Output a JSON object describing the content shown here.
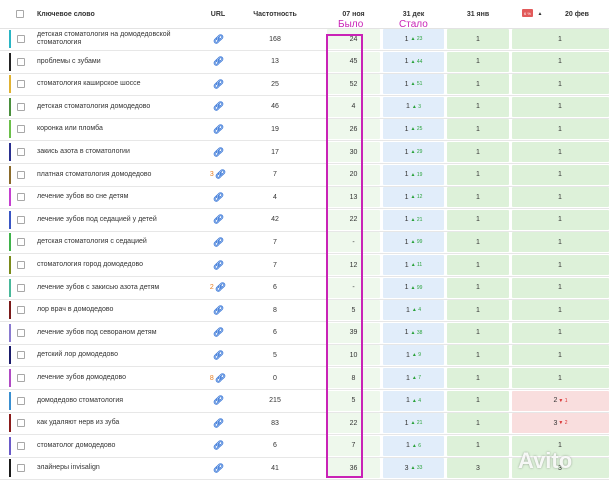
{
  "header": {
    "keyword": "Ключевое слово",
    "url": "URL",
    "frequency": "Частотность",
    "d1": "07 ноя",
    "d2": "31 дек",
    "d3": "31 янв",
    "d4": "20 фев",
    "badge": "6 %",
    "sort_arrow": "▲"
  },
  "annotations": {
    "was": "Было",
    "became": "Стало"
  },
  "watermark": "Avito",
  "rows": [
    {
      "kw": "детская стоматология на домодедовской стоматология",
      "urlnum": "",
      "freq": "168",
      "p1": "24",
      "p2": "1",
      "p2c": "▲ 23",
      "p3": "1",
      "p4": "1",
      "p4c": "",
      "color": "#2ab5c4"
    },
    {
      "kw": "проблемы с зубами",
      "urlnum": "",
      "freq": "13",
      "p1": "45",
      "p2": "1",
      "p2c": "▲ 44",
      "p3": "1",
      "p4": "1",
      "p4c": "",
      "color": "#222222"
    },
    {
      "kw": "стоматология каширское шоссе",
      "urlnum": "",
      "freq": "25",
      "p1": "52",
      "p2": "1",
      "p2c": "▲ 51",
      "p3": "1",
      "p4": "1",
      "p4c": "",
      "color": "#e0b233"
    },
    {
      "kw": "детская стоматология домодедово",
      "urlnum": "",
      "freq": "46",
      "p1": "4",
      "p2": "1",
      "p2c": "▲ 3",
      "p3": "1",
      "p4": "1",
      "p4c": "",
      "color": "#4a8f3c"
    },
    {
      "kw": "коронка или пломба",
      "urlnum": "",
      "freq": "19",
      "p1": "26",
      "p2": "1",
      "p2c": "▲ 25",
      "p3": "1",
      "p4": "1",
      "p4c": "",
      "color": "#6bbf4a"
    },
    {
      "kw": "закись азота в стоматологии",
      "urlnum": "",
      "freq": "17",
      "p1": "30",
      "p2": "1",
      "p2c": "▲ 29",
      "p3": "1",
      "p4": "1",
      "p4c": "",
      "color": "#2a2f8f"
    },
    {
      "kw": "платная стоматология домодедово",
      "urlnum": "3",
      "freq": "7",
      "p1": "20",
      "p2": "1",
      "p2c": "▲ 19",
      "p3": "1",
      "p4": "1",
      "p4c": "",
      "color": "#8a6a2a"
    },
    {
      "kw": "лечение зубов во сне детям",
      "urlnum": "",
      "freq": "4",
      "p1": "13",
      "p2": "1",
      "p2c": "▲ 12",
      "p3": "1",
      "p4": "1",
      "p4c": "",
      "color": "#c43fd0"
    },
    {
      "kw": "лечение зубов под седацией у детей",
      "urlnum": "",
      "freq": "42",
      "p1": "22",
      "p2": "1",
      "p2c": "▲ 21",
      "p3": "1",
      "p4": "1",
      "p4c": "",
      "color": "#3a56c4"
    },
    {
      "kw": "детская стоматология с седацией",
      "urlnum": "",
      "freq": "7",
      "p1": "-",
      "p2": "1",
      "p2c": "▲ 99",
      "p3": "1",
      "p4": "1",
      "p4c": "",
      "color": "#3fb24a"
    },
    {
      "kw": "стоматология город домодедово",
      "urlnum": "",
      "freq": "7",
      "p1": "12",
      "p2": "1",
      "p2c": "▲ 11",
      "p3": "1",
      "p4": "1",
      "p4c": "",
      "color": "#7a8a1a"
    },
    {
      "kw": "лечение зубов с закисью азота детям",
      "urlnum": "2",
      "freq": "6",
      "p1": "-",
      "p2": "1",
      "p2c": "▲ 99",
      "p3": "1",
      "p4": "1",
      "p4c": "",
      "color": "#49b89a"
    },
    {
      "kw": "лор врач в домодедово",
      "urlnum": "",
      "freq": "8",
      "p1": "5",
      "p2": "1",
      "p2c": "▲ 4",
      "p3": "1",
      "p4": "1",
      "p4c": "",
      "color": "#7a1a1a"
    },
    {
      "kw": "лечение зубов под севораном детям",
      "urlnum": "",
      "freq": "6",
      "p1": "39",
      "p2": "1",
      "p2c": "▲ 38",
      "p3": "1",
      "p4": "1",
      "p4c": "",
      "color": "#8a7ad0"
    },
    {
      "kw": "детский лор домодедово",
      "urlnum": "",
      "freq": "5",
      "p1": "10",
      "p2": "1",
      "p2c": "▲ 9",
      "p3": "1",
      "p4": "1",
      "p4c": "",
      "color": "#1a1a6a"
    },
    {
      "kw": "лечение зубов домодедово",
      "urlnum": "8",
      "freq": "0",
      "p1": "8",
      "p2": "1",
      "p2c": "▲ 7",
      "p3": "1",
      "p4": "1",
      "p4c": "",
      "color": "#b04ac4"
    },
    {
      "kw": "домодедово стоматология",
      "urlnum": "",
      "freq": "215",
      "p1": "5",
      "p2": "1",
      "p2c": "▲ 4",
      "p3": "1",
      "p4": "2",
      "p4c": "▼ 1",
      "color": "#3a8fd0"
    },
    {
      "kw": "как удаляют нерв из зуба",
      "urlnum": "",
      "freq": "83",
      "p1": "22",
      "p2": "1",
      "p2c": "▲ 21",
      "p3": "1",
      "p4": "3",
      "p4c": "▼ 2",
      "color": "#8a1a1a"
    },
    {
      "kw": "стоматолог домодедово",
      "urlnum": "",
      "freq": "6",
      "p1": "7",
      "p2": "1",
      "p2c": "▲ 6",
      "p3": "1",
      "p4": "1",
      "p4c": "",
      "color": "#6a5ac8"
    },
    {
      "kw": "элайнеры invisalign",
      "urlnum": "",
      "freq": "41",
      "p1": "36",
      "p2": "3",
      "p2c": "▲ 33",
      "p3": "3",
      "p4": "3",
      "p4c": "",
      "color": "#1a1a1a"
    }
  ]
}
